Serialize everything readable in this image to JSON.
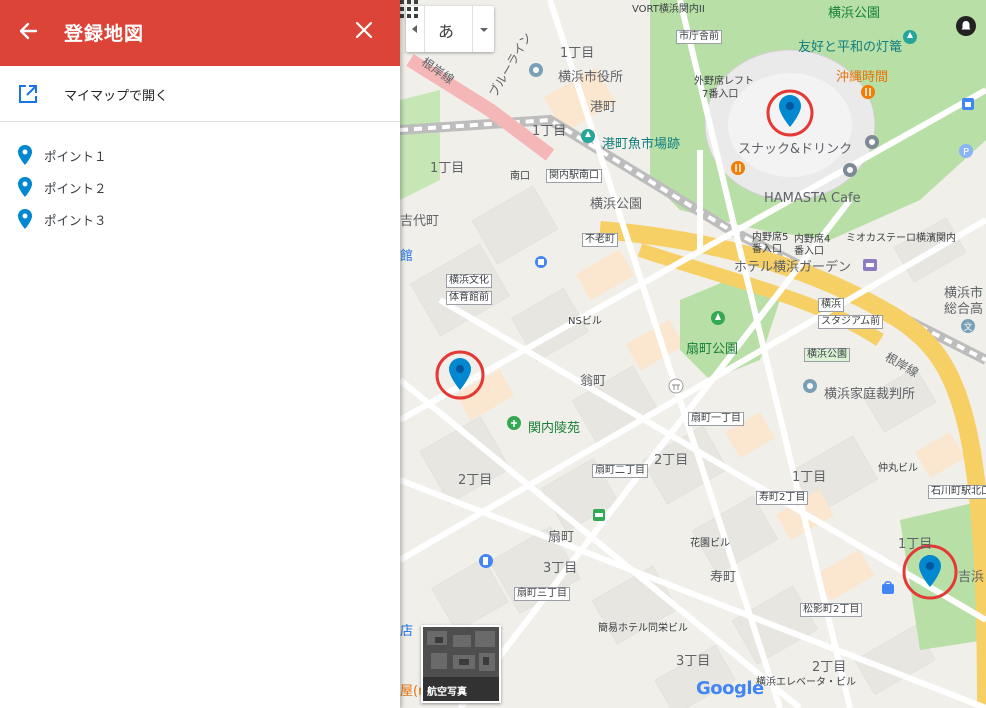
{
  "panel": {
    "title": "登録地図",
    "open_mymaps_label": "マイマップで開く",
    "points": [
      {
        "label": "ポイント１"
      },
      {
        "label": "ポイント２"
      },
      {
        "label": "ポイント３"
      }
    ]
  },
  "map": {
    "language_button": "あ",
    "aerial_label": "航空写真",
    "google_logo": "Google",
    "labels": {
      "yokohama_park": "横浜公園",
      "yuko_heiwa": "友好と平和の灯篭",
      "okinawa": "沖縄時間",
      "city_hall": "横浜市役所",
      "minato_cho": "港町",
      "chome1_a": "1丁目",
      "chome1_b": "1丁目",
      "chome1_c": "1丁目",
      "minato_fish": "港町魚市場跡",
      "snack": "スナック&ドリンク",
      "hamasta": "HAMASTA Cafe",
      "yokohama_koen_road": "横浜公園",
      "hotel_garden": "ホテル横浜ガーデン",
      "yokohama_city_general": "横浜市",
      "yokohama_city_general2": "総合高",
      "ogimachi_park": "扇町公園",
      "okina_cho": "翁町",
      "family_court": "横浜家庭裁判所",
      "kannai_ryoen": "関内陵苑",
      "chome2_a": "2丁目",
      "chome2_b": "2丁目",
      "chome2_c": "2丁目",
      "chome3_a": "3丁目",
      "chome3_b": "3丁目",
      "ogimachi": "扇町",
      "kotobuki": "寿町",
      "yoshihama": "吉浜",
      "sakuragi_line": "根岸線",
      "blue_line": "ブルーライン",
      "negishi2": "根岸線",
      "ns_bldg": "NSビル",
      "nakamaru": "仲丸ビル",
      "kaen_bldg": "花園ビル",
      "hotel_dobou": "簡易ホテル同栄ビル",
      "yokohama_elevator": "横浜エレベータ・ビル",
      "left_field": "外野席レフト",
      "gate7": "7番入口",
      "naiya5": "内野席5",
      "gate5": "番入口",
      "naiya4": "内野席4",
      "gate4": "番入口",
      "mio": "ミオカステーロ横濱関内",
      "shiyakusho_mae": "市庁舎前",
      "vort": "VORT横浜関内II",
      "minami_guchi": "南口",
      "kan": "館",
      "dai_cho": "吉代町",
      "ten": "店",
      "ya": "屋(r"
    },
    "stations": {
      "kannai_south": "関内駅南口",
      "furou": "不老町",
      "bunka1": "横浜文化",
      "bunka2": "体育館前",
      "yokohama_stadium1": "横浜",
      "yokohama_stadium2": "スタジアム前",
      "yokohama_park_stop": "横浜公園",
      "ogimachi1": "扇町一丁目",
      "ogimachi2": "扇町二丁目",
      "ogimachi3": "扇町三丁目",
      "kotobuki2": "寿町2丁目",
      "matsukage2": "松影町2丁目",
      "ishikawa": "石川町駅北口",
      "shiyakusho": "市庁舎前"
    }
  },
  "colors": {
    "header_red": "#db4437",
    "pin_blue": "#0288d1",
    "highlight_ring": "#e53935",
    "park_green": "#c8e6c9"
  }
}
